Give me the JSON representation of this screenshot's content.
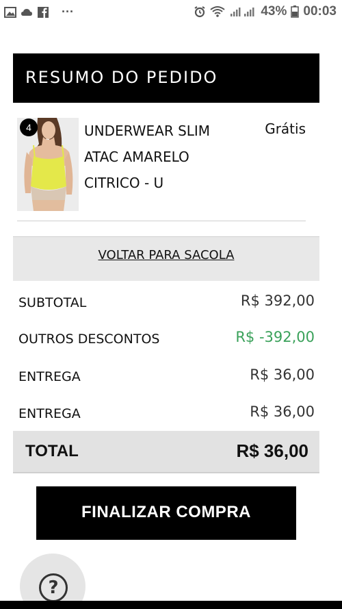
{
  "status_bar": {
    "left_icons": [
      "image-icon",
      "cloud-icon",
      "facebook-icon",
      "more-icon"
    ],
    "more_glyph": "···",
    "battery": "43%",
    "time": "00:03"
  },
  "header": {
    "title": "RESUMO DO PEDIDO"
  },
  "product": {
    "quantity": "4",
    "name_lines": [
      "UNDERWEAR SLIM",
      "ATAC AMARELO",
      "CITRICO - U"
    ],
    "price": "Grátis"
  },
  "back_to_bag": "VOLTAR PARA SACOLA",
  "summary": {
    "rows": [
      {
        "label": "SUBTOTAL",
        "value": "R$ 392,00"
      },
      {
        "label": "OUTROS DESCONTOS",
        "value": "R$ -392,00"
      },
      {
        "label": "ENTREGA",
        "value": "R$ 36,00"
      },
      {
        "label": "ENTREGA",
        "value": "R$ 36,00"
      }
    ],
    "total_label": "TOTAL",
    "total_value": "R$ 36,00"
  },
  "checkout_label": "FINALIZAR COMPRA",
  "help_glyph": "?",
  "colors": {
    "discount": "#3aa15a",
    "header_bg": "#000000"
  }
}
